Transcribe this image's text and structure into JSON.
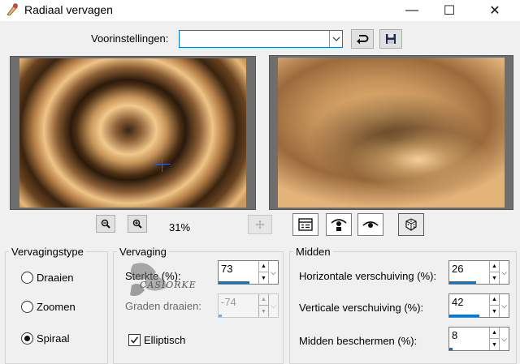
{
  "window": {
    "title": "Radiaal vervagen",
    "minimize_glyph": "—",
    "maximize_glyph": "☐",
    "close_glyph": "✕"
  },
  "presets": {
    "label": "Voorinstellingen:",
    "value": ""
  },
  "zoom": {
    "level": "31%"
  },
  "watermark": "CASIORKE",
  "fade_type": {
    "legend": "Vervagingstype",
    "options": [
      "Draaien",
      "Zoomen",
      "Spiraal"
    ],
    "selected": "Spiraal"
  },
  "fade": {
    "legend": "Vervaging",
    "strength_label": "Sterkte (%):",
    "strength_value": "73",
    "strength_fraction": 0.73,
    "rotate_label": "Graden draaien:",
    "rotate_value": "-74",
    "rotate_fraction": 0.07,
    "elliptical_label": "Elliptisch",
    "elliptical_checked": true
  },
  "center": {
    "legend": "Midden",
    "horizontal_label": "Horizontale verschuiving (%):",
    "horizontal_value": "26",
    "horizontal_fraction": 0.63,
    "vertical_label": "Verticale verschuiving (%):",
    "vertical_value": "42",
    "vertical_fraction": 0.71,
    "protect_label": "Midden beschermen (%):",
    "protect_value": "8",
    "protect_fraction": 0.08
  },
  "colors": {
    "accent": "#0078d7",
    "dialog_bg": "#f0f0f0"
  }
}
